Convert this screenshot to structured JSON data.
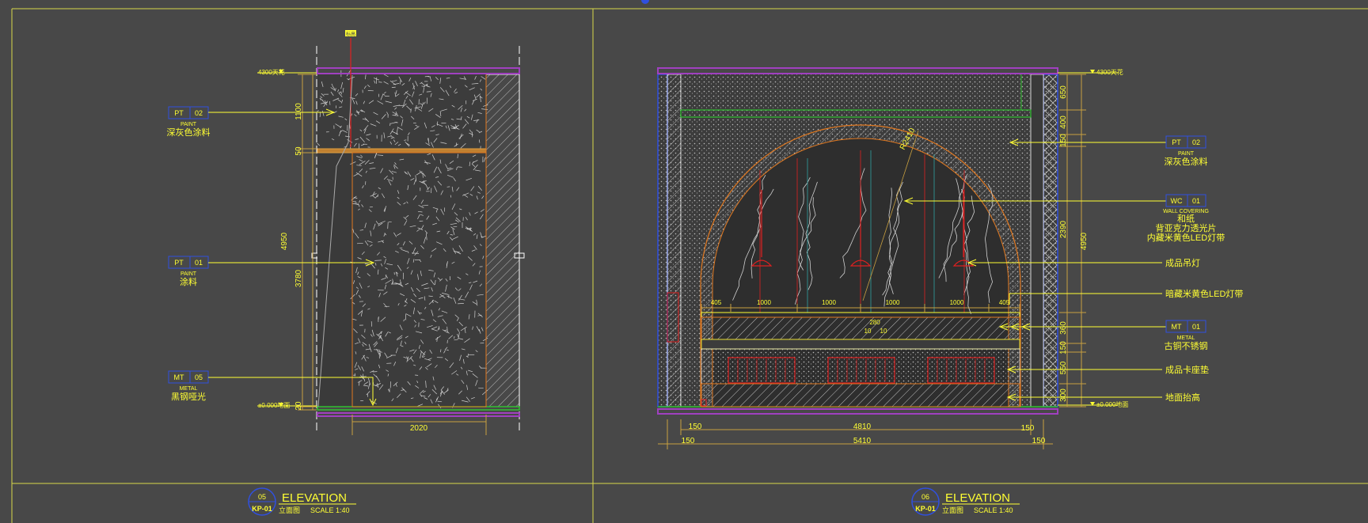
{
  "colors": {
    "background": "#484848",
    "frame": "#d8d84a",
    "yellow": "#ffff33",
    "purple": "#a040c0",
    "red": "#e02020",
    "orange": "#e07820",
    "green": "#30c030",
    "blue": "#3050e0",
    "dim": "#c8a040"
  },
  "left": {
    "top_marker": "标高",
    "ceiling_level": "4300天花",
    "floor_level": "±0.000地面",
    "dims_vertical": [
      "1100",
      "50",
      "3780",
      "20"
    ],
    "dim_total": "4950",
    "dim_width": "2020",
    "callouts": [
      {
        "code": "PT",
        "num": "02",
        "en": "PAINT",
        "zh": "深灰色涂料"
      },
      {
        "code": "PT",
        "num": "01",
        "en": "PAINT",
        "zh": "涂料"
      },
      {
        "code": "MT",
        "num": "05",
        "en": "METAL",
        "zh": "黑钢哑光"
      }
    ],
    "title": {
      "num": "05",
      "sheet": "KP-01",
      "name": "ELEVATION",
      "zh": "立面图",
      "scale": "SCALE   1:40"
    }
  },
  "right": {
    "ceiling_level": "4300天花",
    "floor_level": "±0.000地面",
    "radius": "R2410",
    "dims_vertical": [
      "650",
      "400",
      "150",
      "2390",
      "360",
      "150",
      "550",
      "300"
    ],
    "dim_total": "4950",
    "dims_top": [
      "405",
      "1000",
      "1000",
      "1000",
      "1000",
      "405"
    ],
    "dim_bench": [
      "280",
      "10",
      "10"
    ],
    "dims_bottom1": [
      "150",
      "4810",
      "150"
    ],
    "dims_bottom2": [
      "150",
      "5410",
      "150"
    ],
    "callouts": [
      {
        "code": "PT",
        "num": "02",
        "en": "PAINT",
        "zh": "深灰色涂料"
      },
      {
        "code": "WC",
        "num": "01",
        "en": "WALL COVERING",
        "zh": "和纸",
        "zh2": "背亚克力透光片",
        "zh3": "内藏米黄色LED灯带"
      }
    ],
    "notes": [
      "成品吊灯",
      "暗藏米黄色LED灯带",
      "成品卡座垫",
      "地面抬高"
    ],
    "mt_callout": {
      "code": "MT",
      "num": "01",
      "en": "METAL",
      "zh": "古铜不锈钢"
    },
    "title": {
      "num": "06",
      "sheet": "KP-01",
      "name": "ELEVATION",
      "zh": "立面图",
      "scale": "SCALE   1:40"
    }
  }
}
